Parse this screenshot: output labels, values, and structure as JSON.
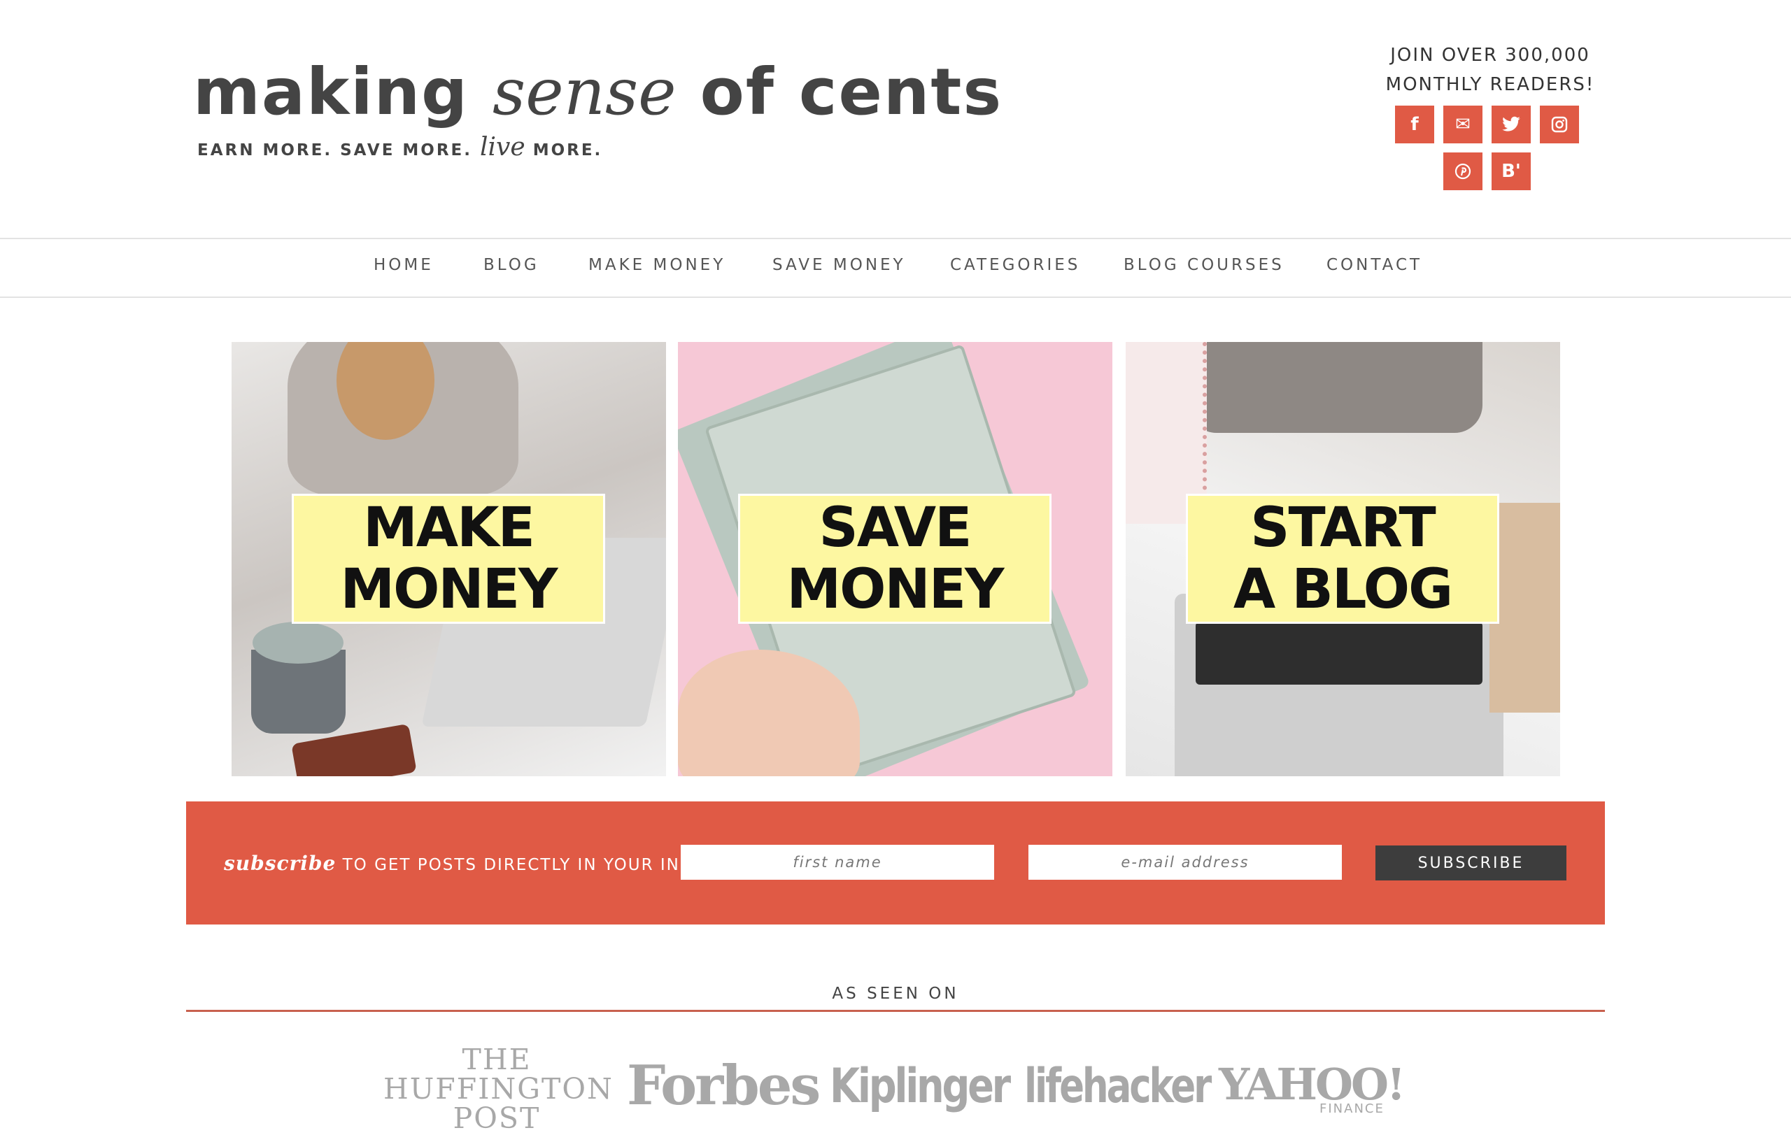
{
  "header": {
    "logo_part1": "making ",
    "logo_part2": "sense",
    "logo_part3": " of cents",
    "tagline_part1": "EARN MORE. SAVE MORE. ",
    "tagline_live": "live",
    "tagline_part2": " MORE.",
    "join_line1": "JOIN OVER 300,000",
    "join_line2": "MONTHLY READERS!",
    "social": [
      {
        "icon": "facebook-icon",
        "glyph": "f"
      },
      {
        "icon": "email-icon",
        "glyph": "✉"
      },
      {
        "icon": "twitter-icon",
        "glyph": "🐦"
      },
      {
        "icon": "instagram-icon",
        "glyph": "◎"
      },
      {
        "icon": "pinterest-icon",
        "glyph": "℗"
      },
      {
        "icon": "bloglovin-icon",
        "glyph": "B'"
      }
    ]
  },
  "nav": {
    "items": [
      "HOME",
      "BLOG",
      "MAKE MONEY",
      "SAVE MONEY",
      "CATEGORIES",
      "BLOG COURSES",
      "CONTACT"
    ]
  },
  "tiles": [
    {
      "line1": "MAKE",
      "line2": "MONEY"
    },
    {
      "line1": "SAVE",
      "line2": "MONEY"
    },
    {
      "line1": "START",
      "line2": "A BLOG"
    }
  ],
  "subscribe": {
    "emphasis": "subscribe",
    "text": " TO GET POSTS DIRECTLY IN YOUR INBOX!",
    "first_name_placeholder": "first name",
    "email_placeholder": "e-mail address",
    "button_label": "SUBSCRIBE"
  },
  "as_seen_on": {
    "title": "AS SEEN ON",
    "huffington_line1": "THE",
    "huffington_line2": "HUFFINGTON",
    "huffington_line3": "POST",
    "forbes": "Forbes",
    "kiplinger": "Kiplinger",
    "lifehacker": "lifehacker",
    "yahoo": "YAHOO!",
    "yahoo_sub": "FINANCE"
  },
  "colors": {
    "accent": "#e05a45",
    "dark_button": "#3d3d3d",
    "label_yellow": "#fdf7a1"
  }
}
